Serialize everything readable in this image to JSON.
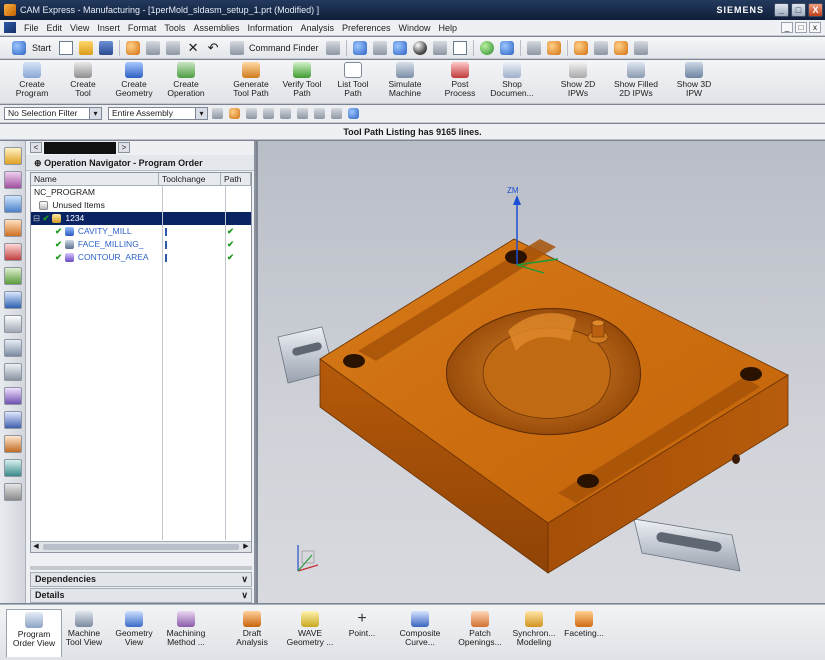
{
  "window": {
    "title": "CAM Express - Manufacturing - [1perMold_sldasm_setup_1.prt (Modified) ]",
    "brand": "SIEMENS",
    "min": "_",
    "max": "□",
    "close": "X"
  },
  "menu": {
    "items": [
      "File",
      "Edit",
      "View",
      "Insert",
      "Format",
      "Tools",
      "Assemblies",
      "Information",
      "Analysis",
      "Preferences",
      "Window",
      "Help"
    ],
    "mini_buttons": [
      "_",
      "□",
      "x"
    ]
  },
  "standard_toolbar": {
    "start_label": "Start",
    "command_finder": "Command Finder"
  },
  "manufacturing_toolbar": {
    "buttons": [
      {
        "label": "Create\nProgram",
        "icon": "create-program-icon"
      },
      {
        "label": "Create\nTool",
        "icon": "create-tool-icon"
      },
      {
        "label": "Create\nGeometry",
        "icon": "create-geometry-icon"
      },
      {
        "label": "Create\nOperation",
        "icon": "create-operation-icon"
      },
      {
        "label": "Generate\nTool Path",
        "icon": "generate-toolpath-icon"
      },
      {
        "label": "Verify Tool\nPath",
        "icon": "verify-toolpath-icon"
      },
      {
        "label": "List Tool\nPath",
        "icon": "list-toolpath-icon"
      },
      {
        "label": "Simulate\nMachine",
        "icon": "simulate-machine-icon"
      },
      {
        "label": "Post\nProcess",
        "icon": "post-process-icon"
      },
      {
        "label": "Shop\nDocumen...",
        "icon": "shop-documentation-icon"
      },
      {
        "label": "Show 2D\nIPWs",
        "icon": "show-2d-ipw-icon"
      },
      {
        "label": "Show Filled\n2D IPWs",
        "icon": "show-filled-2d-ipw-icon"
      },
      {
        "label": "Show 3D\nIPW",
        "icon": "show-3d-ipw-icon"
      }
    ]
  },
  "selection_bar": {
    "filter": "No Selection Filter",
    "scope": "Entire Assembly"
  },
  "status_line": "Tool Path Listing has 9165 lines.",
  "navigator": {
    "title": "Operation Navigator - Program Order",
    "columns": [
      "Name",
      "Toolchange",
      "Path"
    ],
    "rows": [
      {
        "name": "NC_PROGRAM",
        "toolchange": "",
        "path": "",
        "indent": 0,
        "selected": false,
        "link": false
      },
      {
        "name": "Unused Items",
        "toolchange": "",
        "path": "",
        "indent": 1,
        "selected": false,
        "link": false
      },
      {
        "name": "1234",
        "toolchange": "",
        "path": "",
        "indent": 1,
        "selected": true,
        "link": false
      },
      {
        "name": "CAVITY_MILL",
        "toolchange": "",
        "path": "✔",
        "indent": 2,
        "selected": false,
        "link": true
      },
      {
        "name": "FACE_MILLING_",
        "toolchange": "",
        "path": "✔",
        "indent": 2,
        "selected": false,
        "link": true
      },
      {
        "name": "CONTOUR_AREA",
        "toolchange": "",
        "path": "✔",
        "indent": 2,
        "selected": false,
        "link": true
      }
    ],
    "panels": [
      "Dependencies",
      "Details"
    ]
  },
  "graphics": {
    "axis_z_label": "ZM",
    "mold_color": "#c8680c"
  },
  "bottom_toolbar": {
    "buttons": [
      {
        "label": "Program\nOrder View",
        "active": true
      },
      {
        "label": "Machine\nTool View",
        "active": false
      },
      {
        "label": "Geometry\nView",
        "active": false
      },
      {
        "label": "Machining\nMethod ...",
        "active": false
      },
      {
        "label": "Draft\nAnalysis",
        "active": false
      },
      {
        "label": "WAVE\nGeometry ...",
        "active": false
      },
      {
        "label": "Point...",
        "active": false
      },
      {
        "label": "Composite\nCurve...",
        "active": false
      },
      {
        "label": "Patch\nOpenings...",
        "active": false
      },
      {
        "label": "Synchron...\nModeling",
        "active": false
      },
      {
        "label": "Faceting...",
        "active": false
      }
    ]
  }
}
